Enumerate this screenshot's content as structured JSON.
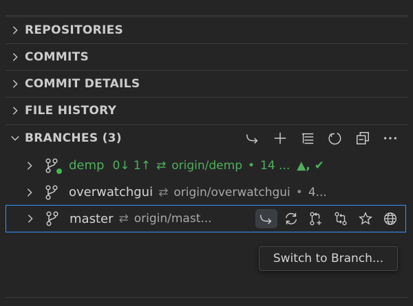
{
  "sections": [
    {
      "label": "REPOSITORIES"
    },
    {
      "label": "COMMITS"
    },
    {
      "label": "COMMIT DETAILS"
    },
    {
      "label": "FILE HISTORY"
    }
  ],
  "branches": {
    "title": "BRANCHES (3)",
    "toolbar_icons": [
      "switch-branch-icon",
      "plus-icon",
      "list-view-icon",
      "refresh-icon",
      "collapse-all-icon",
      "more-icon"
    ],
    "items": [
      {
        "name": "demp",
        "sync": "0↓ 1↑",
        "arrow": "⇄",
        "upstream": "origin/demp",
        "bullet": "•",
        "extra": "14 ...",
        "status": "▲, ✔",
        "current": true,
        "color": "#4fb05a"
      },
      {
        "name": "overwatchgui",
        "arrow": "⇄",
        "upstream": "origin/overwatchgui",
        "bullet": "•",
        "extra": "4..."
      },
      {
        "name": "master",
        "arrow": "⇄",
        "upstream": "origin/mast...",
        "selected": true,
        "action_icons": [
          "switch-branch-icon",
          "sync-icon",
          "create-pull-request-icon",
          "compare-icon",
          "star-icon",
          "globe-icon"
        ]
      }
    ]
  },
  "tooltip": "Switch to Branch...",
  "colors": {
    "accent": "#3794ff",
    "green": "#4fb05a",
    "background": "#252526"
  }
}
